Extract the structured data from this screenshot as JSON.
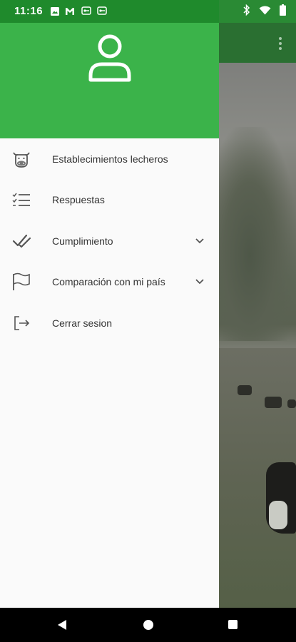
{
  "status_bar": {
    "time": "11:16",
    "left_icons": [
      "image-icon",
      "gmail-icon",
      "vpn-key-icon",
      "vpn-key-icon"
    ],
    "right_icons": [
      "bluetooth-icon",
      "wifi-icon",
      "battery-icon"
    ]
  },
  "drawer": {
    "header_icon": "user-avatar-icon",
    "header_color": "#3bb34a",
    "items": [
      {
        "label": "Establecimientos lecheros",
        "icon": "cow-icon",
        "expandable": false
      },
      {
        "label": "Respuestas",
        "icon": "checklist-icon",
        "expandable": false
      },
      {
        "label": "Cumplimiento",
        "icon": "double-check-icon",
        "expandable": true
      },
      {
        "label": "Comparación con mi país",
        "icon": "flag-icon",
        "expandable": true
      },
      {
        "label": "Cerrar sesion",
        "icon": "logout-icon",
        "expandable": false
      }
    ]
  },
  "app_bar": {
    "color": "#2a6f31",
    "overflow_icon": "more-vert-icon"
  },
  "nav_bar": {
    "buttons": [
      "back-icon",
      "home-icon",
      "recents-icon"
    ]
  }
}
